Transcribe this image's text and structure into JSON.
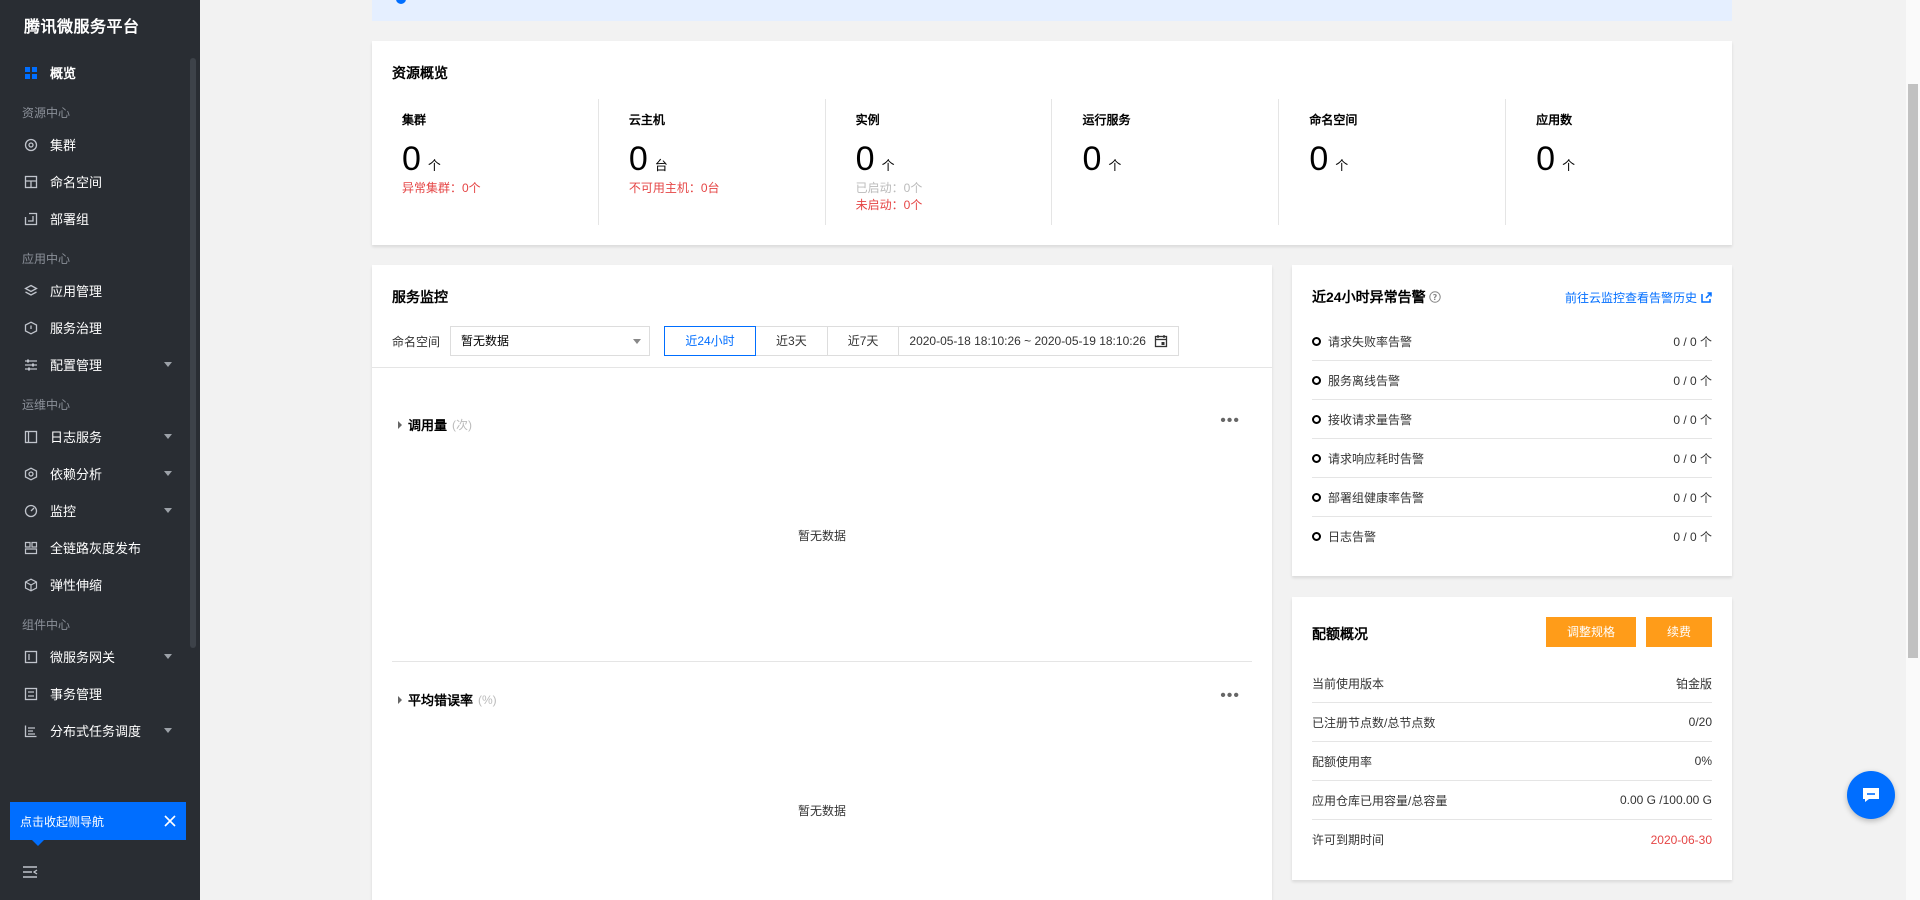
{
  "sidebar": {
    "title": "腾讯微服务平台",
    "overview": "概览",
    "groups": [
      {
        "label": "资源中心",
        "items": [
          {
            "label": "集群",
            "icon": "cluster-icon",
            "caret": false
          },
          {
            "label": "命名空间",
            "icon": "namespace-icon",
            "caret": false
          },
          {
            "label": "部署组",
            "icon": "deploy-group-icon",
            "caret": false
          }
        ]
      },
      {
        "label": "应用中心",
        "items": [
          {
            "label": "应用管理",
            "icon": "layers-icon",
            "caret": false
          },
          {
            "label": "服务治理",
            "icon": "shield-icon",
            "caret": false
          },
          {
            "label": "配置管理",
            "icon": "sliders-icon",
            "caret": true
          }
        ]
      },
      {
        "label": "运维中心",
        "items": [
          {
            "label": "日志服务",
            "icon": "log-icon",
            "caret": true
          },
          {
            "label": "依赖分析",
            "icon": "dependency-icon",
            "caret": true
          },
          {
            "label": "监控",
            "icon": "monitor-icon",
            "caret": true
          },
          {
            "label": "全链路灰度发布",
            "icon": "gray-release-icon",
            "caret": false
          },
          {
            "label": "弹性伸缩",
            "icon": "cube-icon",
            "caret": false
          }
        ]
      },
      {
        "label": "组件中心",
        "items": [
          {
            "label": "微服务网关",
            "icon": "gateway-icon",
            "caret": true
          },
          {
            "label": "事务管理",
            "icon": "transaction-icon",
            "caret": false
          },
          {
            "label": "分布式任务调度",
            "icon": "schedule-icon",
            "caret": true
          }
        ]
      }
    ],
    "tooltip": "点击收起侧导航"
  },
  "resources": {
    "title": "资源概览",
    "cells": [
      {
        "label": "集群",
        "value": "0",
        "unit": "个",
        "subs": [
          {
            "text": "异常集群：0个",
            "tone": "red"
          }
        ]
      },
      {
        "label": "云主机",
        "value": "0",
        "unit": "台",
        "subs": [
          {
            "text": "不可用主机：0台",
            "tone": "red"
          }
        ]
      },
      {
        "label": "实例",
        "value": "0",
        "unit": "个",
        "subs": [
          {
            "text": "已启动：0个",
            "tone": "grey"
          },
          {
            "text": "未启动：0个",
            "tone": "red"
          }
        ]
      },
      {
        "label": "运行服务",
        "value": "0",
        "unit": "个",
        "subs": []
      },
      {
        "label": "命名空间",
        "value": "0",
        "unit": "个",
        "subs": []
      },
      {
        "label": "应用数",
        "value": "0",
        "unit": "个",
        "subs": []
      }
    ]
  },
  "monitor": {
    "title": "服务监控",
    "namespace_label": "命名空间",
    "namespace_value": "暂无数据",
    "tabs": [
      "近24小时",
      "近3天",
      "近7天"
    ],
    "active_tab": 0,
    "range": "2020-05-18 18:10:26 ~ 2020-05-19 18:10:26",
    "sections": [
      {
        "title": "调用量",
        "unit": "(次)",
        "empty": "暂无数据"
      },
      {
        "title": "平均错误率",
        "unit": "(%)",
        "empty": "暂无数据"
      }
    ],
    "more": "•••"
  },
  "alerts": {
    "title": "近24小时异常告警",
    "link": "前往云监控查看告警历史",
    "rows": [
      {
        "label": "请求失败率告警",
        "value": "0 / 0 个"
      },
      {
        "label": "服务离线告警",
        "value": "0 / 0 个"
      },
      {
        "label": "接收请求量告警",
        "value": "0 / 0 个"
      },
      {
        "label": "请求响应耗时告警",
        "value": "0 / 0 个"
      },
      {
        "label": "部署组健康率告警",
        "value": "0 / 0 个"
      },
      {
        "label": "日志告警",
        "value": "0 / 0 个"
      }
    ]
  },
  "quota": {
    "title": "配额概况",
    "btn_adjust": "调整规格",
    "btn_renew": "续费",
    "rows": [
      {
        "label": "当前使用版本",
        "value": "铂金版",
        "tone": ""
      },
      {
        "label": "已注册节点数/总节点数",
        "value": "0/20",
        "tone": ""
      },
      {
        "label": "配额使用率",
        "value": "0%",
        "tone": ""
      },
      {
        "label": "应用仓库已用容量/总容量",
        "value": "0.00 G /100.00 G",
        "tone": ""
      },
      {
        "label": "许可到期时间",
        "value": "2020-06-30",
        "tone": "red"
      }
    ]
  },
  "colors": {
    "accent": "#006eff",
    "warning": "#ff9c19",
    "danger": "#e54545",
    "sidebar_bg": "#292d33"
  }
}
